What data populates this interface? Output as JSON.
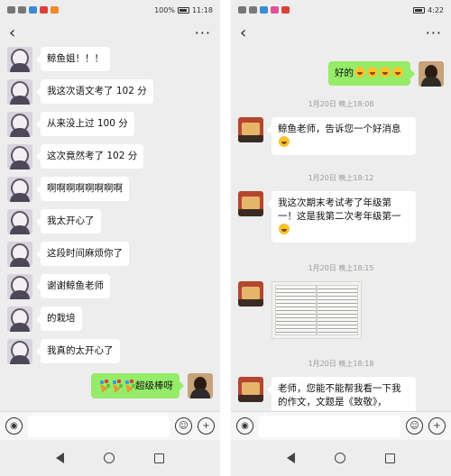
{
  "left": {
    "status": {
      "left_icons": [
        "signal-icon",
        "wifi-icon",
        "app-icon",
        "app-icon",
        "app-icon"
      ],
      "battery": "100%",
      "time": "11:18"
    },
    "title": {
      "back_icon": "‹",
      "more_icon": "···"
    },
    "messages": [
      {
        "side": "left",
        "text": "鲸鱼姐！！！"
      },
      {
        "side": "left",
        "text": "我这次语文考了 102 分"
      },
      {
        "side": "left",
        "text": "从来没上过 100 分"
      },
      {
        "side": "left",
        "text": "这次竟然考了 102 分"
      },
      {
        "side": "left",
        "text": "啊啊啊啊啊啊啊啊"
      },
      {
        "side": "left",
        "text": "我太开心了"
      },
      {
        "side": "left",
        "text": "这段时间麻烦你了"
      },
      {
        "side": "left",
        "text": "谢谢鲸鱼老师"
      },
      {
        "side": "left",
        "text": "的栽培"
      },
      {
        "side": "left",
        "text": "我真的太开心了"
      },
      {
        "side": "right",
        "text": "超级棒呀",
        "prefix_icons": [
          "party-popper-icon",
          "party-popper-icon",
          "party-popper-icon"
        ]
      }
    ]
  },
  "right": {
    "status": {
      "time": "4:22"
    },
    "title": {
      "back_icon": "‹",
      "more_icon": "···"
    },
    "top_message": {
      "text": "好的",
      "suffix_icons": [
        "grin-emoji-icon",
        "grin-emoji-icon",
        "grin-emoji-icon",
        "grin-emoji-icon"
      ]
    },
    "timestamps": [
      "1月20日 晚上18:08",
      "1月20日 晚上18:12",
      "1月20日 晚上18:15",
      "1月20日 晚上18:18"
    ],
    "messages": [
      {
        "text": "鲸鱼老师，告诉您一个好消息"
      },
      {
        "text": "我这次期末考试考了年级第一！这是我第二次考年级第一"
      },
      {
        "text": "[photo of essay pages]"
      },
      {
        "text": "老师，您能不能帮我看一下我的作文，文题是《致敬》，"
      }
    ]
  },
  "input": {
    "voice_icon": "voice-icon",
    "emoji_icon": "emoji-icon",
    "plus_icon": "plus-icon"
  },
  "colors": {
    "bg": "#ededed",
    "green_bubble": "#95ec69",
    "white_bubble": "#ffffff"
  }
}
